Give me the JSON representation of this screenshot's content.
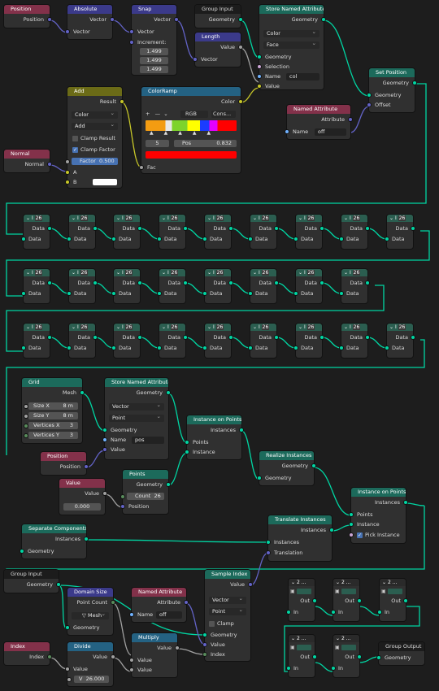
{
  "nodes": {
    "position1": {
      "title": "Position",
      "out": "Position"
    },
    "absolute": {
      "title": "Absolute",
      "out": "Vector",
      "in": "Vector"
    },
    "snap": {
      "title": "Snap",
      "out": "Vector",
      "in_vector": "Vector",
      "in_incr": "Increment:",
      "values": [
        "1.499",
        "1.499",
        "1.499"
      ]
    },
    "group_input1": {
      "title": "Group Input",
      "out": "Geometry"
    },
    "length": {
      "title": "Length",
      "out": "Value",
      "in": "Vector"
    },
    "store_attr1": {
      "title": "Store Named Attribute",
      "out": "Geometry",
      "type": "Color",
      "domain": "Face",
      "in_geo": "Geometry",
      "in_sel": "Selection",
      "name_label": "Name",
      "name_value": "col",
      "in_value": "Value"
    },
    "set_position": {
      "title": "Set Position",
      "out": "Geometry",
      "in_geo": "Geometry",
      "in_offset": "Offset"
    },
    "named_attr1": {
      "title": "Named Attribute",
      "out": "Attribute",
      "name_label": "Name",
      "name_value": "off"
    },
    "add": {
      "title": "Add",
      "out": "Result",
      "type": "Color",
      "op": "Add",
      "clamp_result": "Clamp Result",
      "clamp_factor": "Clamp Factor",
      "factor_label": "Factor",
      "factor_value": "0.500",
      "in_a": "A",
      "in_b": "B"
    },
    "colorramp": {
      "title": "ColorRamp",
      "out": "Color",
      "mode": "RGB",
      "interp": "Cons...",
      "index": "5",
      "pos_label": "Pos",
      "pos_value": "0.832",
      "in_fac": "Fac"
    },
    "normal": {
      "title": "Normal",
      "out": "Normal"
    },
    "grid": {
      "title": "Grid",
      "out": "Mesh",
      "size_x_label": "Size X",
      "size_x": "8 m",
      "size_y_label": "Size Y",
      "size_y": "8 m",
      "vx_label": "Vertices X",
      "vx": "3",
      "vy_label": "Vertices Y",
      "vy": "3"
    },
    "store_attr2": {
      "title": "Store Named Attribute",
      "out": "Geometry",
      "type": "Vector",
      "domain": "Point",
      "in_geo": "Geometry",
      "name_label": "Name",
      "name_value": "pos",
      "in_value": "Value"
    },
    "instance_on_points1": {
      "title": "Instance on Points",
      "out": "Instances",
      "in_points": "Points",
      "in_inst": "Instance"
    },
    "position2": {
      "title": "Position",
      "out": "Position"
    },
    "points": {
      "title": "Points",
      "out": "Geometry",
      "count_label": "Count",
      "count": "26",
      "in_pos": "Position"
    },
    "value_node": {
      "title": "Value",
      "out": "Value",
      "value": "0.000"
    },
    "realize": {
      "title": "Realize Instances",
      "out": "Geometry",
      "in": "Geometry"
    },
    "instance_on_points2": {
      "title": "Instance on Points",
      "out": "Instances",
      "in_points": "Points",
      "in_inst": "Instance",
      "pick": "Pick Instance"
    },
    "separate": {
      "title": "Separate Components",
      "out": "Instances",
      "in": "Geometry"
    },
    "translate": {
      "title": "Translate Instances",
      "out": "Instances",
      "in_inst": "Instances",
      "in_tr": "Translation"
    },
    "group_input2": {
      "title": "Group Input",
      "out": "Geometry"
    },
    "domain_size": {
      "title": "Domain Size",
      "out": "Point Count",
      "domain": "Mesh",
      "in": "Geometry"
    },
    "named_attr2": {
      "title": "Named Attribute",
      "out": "Attribute",
      "name_label": "Name",
      "name_value": "off"
    },
    "sample_index": {
      "title": "Sample Index",
      "out": "Value",
      "type": "Vector",
      "domain": "Point",
      "clamp": "Clamp",
      "in_geo": "Geometry",
      "in_val": "Value",
      "in_idx": "Index"
    },
    "multiply": {
      "title": "Multiply",
      "out": "Value",
      "in1": "Value",
      "in2": "Value"
    },
    "index": {
      "title": "Index",
      "out": "Index"
    },
    "divide": {
      "title": "Divide",
      "out": "Value",
      "in": "Value",
      "v_label": "V",
      "v_value": "26.000"
    },
    "group_output": {
      "title": "Group Output",
      "in": "Geometry"
    }
  },
  "mini": {
    "title": "I",
    "badge": "26",
    "label": "Data"
  },
  "fn": {
    "title": "2 ...",
    "out": "Out",
    "in": "In"
  },
  "colors": {
    "geometry": "#00d6a3",
    "vector": "#6363c7",
    "float": "#a1a1a1",
    "color": "#c7c729",
    "string": "#70b2ff",
    "bool": "#cca6d6"
  }
}
